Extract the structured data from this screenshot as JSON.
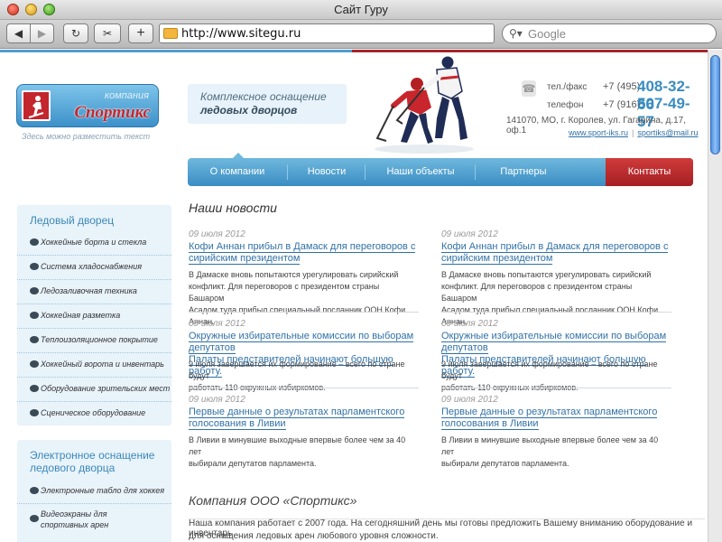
{
  "window": {
    "title": "Сайт Гуру"
  },
  "toolbar": {
    "url": "http://www.sitegu.ru",
    "search_placeholder": "Google",
    "back_icon": "◀",
    "fwd_icon": "▶",
    "reload_icon": "↻",
    "snip_icon": "✂",
    "add_icon": "+"
  },
  "logo": {
    "company": "компания",
    "name": "Спортикс"
  },
  "header": {
    "slogan_small": "Здесь можно разместить текст",
    "tagline_l1": "Комплексное оснащение",
    "tagline_l2": "ледовых дворцов",
    "phone1_label": "тел./факс",
    "phone1_code": "+7 (495)",
    "phone1_number": "408-32-66",
    "phone2_label": "телефон",
    "phone2_code": "+7 (916)",
    "phone2_number": "507-49-57",
    "address": "141070, МО, г. Королев, ул. Гагарина, д.17, оф.1",
    "site_link": "www.sport-iks.ru",
    "separator": "|",
    "email_link": "sportiks@mail.ru"
  },
  "nav": {
    "items": [
      "О компании",
      "Новости",
      "Наши объекты",
      "Партнеры"
    ],
    "contacts": "Контакты"
  },
  "sidebar": {
    "box1_title": "Ледовый дворец",
    "box1_items": [
      "Хоккейные борта и стекла",
      "Система хладоснабжения",
      "Ледозаливочная техника",
      "Хоккейная разметка",
      "Теплоизоляционное покрытие",
      "Хоккейный ворота и инвентарь",
      "Оборудование зрительских мест",
      "Сценическое оборудование"
    ],
    "box2_title_l1": "Электронное оснащение",
    "box2_title_l2": "ледового дворца",
    "box2_items": [
      "Электронные табло для хоккея",
      "Видеоэкраны для",
      "спортивных арен"
    ]
  },
  "news": {
    "heading": "Наши новости",
    "items": [
      {
        "date": "09 июля 2012",
        "t1": "Кофи Аннан прибыл в Дамаск для переговоров с",
        "t2": "сирийским президентом",
        "b1": "В Дамаске вновь попытаются урегулировать сирийский",
        "b2": "конфликт. Для переговоров с президентом страны Башаром",
        "b3": "Асадом туда прибыл специальный посланник ООН Кофи Аннан."
      },
      {
        "date": "09 июля 2012",
        "t1": "Окружные избирательные комиссии по выборам депутатов",
        "t2": "Палаты представителей начинают большую работу.",
        "b1": "9 июля завершается их формирование – всего по стране будут",
        "b2": "работать 110 окружных избиркомов.",
        "b3": ""
      },
      {
        "date": "09 июля 2012",
        "t1": "Первые данные о результатах парламентского",
        "t2": "голосования в Ливии",
        "b1": "В Ливии в минувшие выходные впервые более чем за 40 лет",
        "b2": "выбирали депутатов парламента.",
        "b3": ""
      }
    ]
  },
  "company": {
    "heading": "Компания ООО «Спортикс»",
    "text_l1": "Наша компания работает с 2007 года. На сегодняшний день мы готовы предложить Вашему вниманию оборудование и инвентарь",
    "text_l2": "для оснащения ледовых арен любового уровня сложности."
  }
}
